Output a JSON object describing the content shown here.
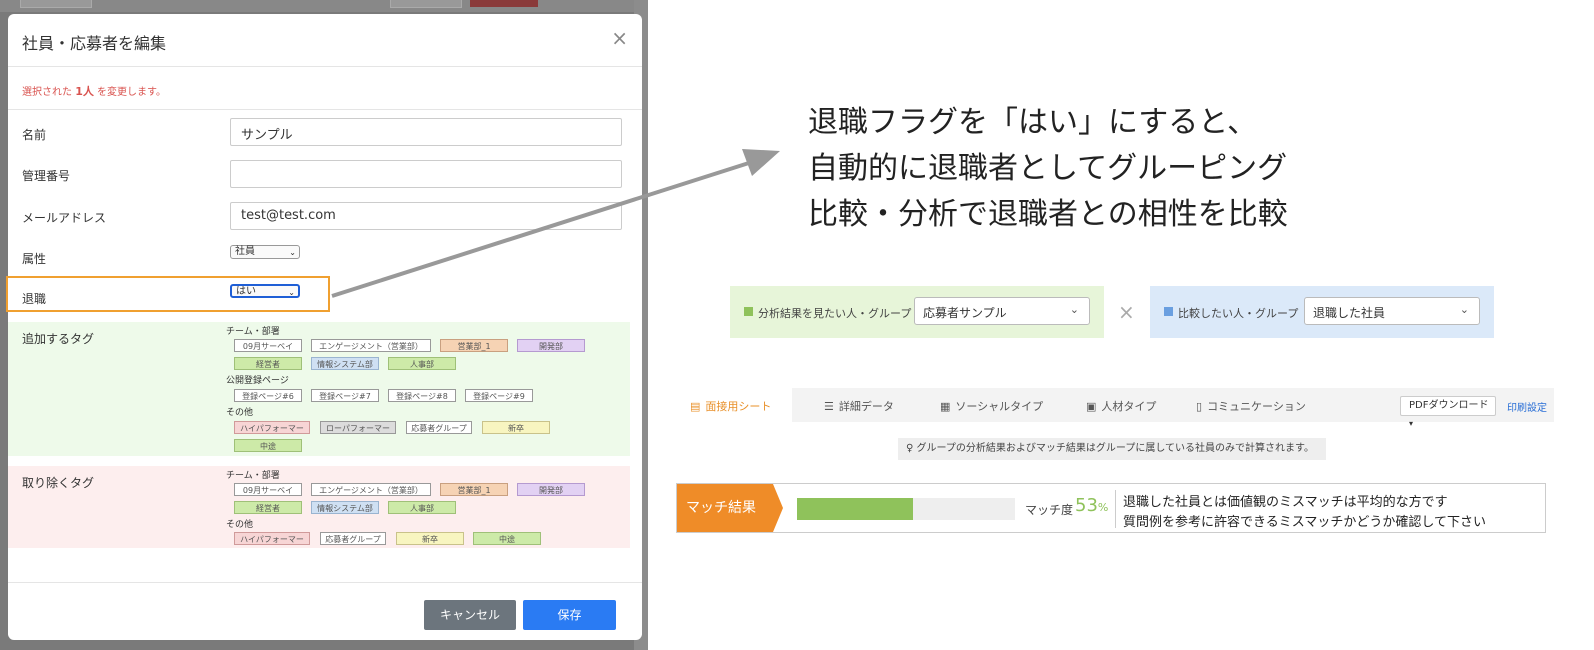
{
  "modal": {
    "title": "社員・応募者を編集",
    "close_glyph": "×",
    "notice_prefix": "選択された",
    "notice_count": "1人",
    "notice_suffix": "を変更します。",
    "fields": {
      "name_label": "名前",
      "name_value": "サンプル",
      "mgmt_label": "管理番号",
      "mgmt_value": "",
      "email_label": "メールアドレス",
      "email_value": "test@test.com",
      "attr_label": "属性",
      "attr_value": "社員",
      "retire_label": "退職",
      "retire_value": "はい"
    },
    "add_tags": {
      "label": "追加するタグ",
      "groups": [
        {
          "title": "チーム・部署",
          "tags": [
            "09月サーベイ",
            "エンゲージメント（営業部）",
            "営業部_1",
            "開発部",
            "経営者",
            "情報システム部",
            "人事部"
          ]
        },
        {
          "title": "公開登録ページ",
          "tags": [
            "登録ページ#6",
            "登録ページ#7",
            "登録ページ#8",
            "登録ページ#9"
          ]
        },
        {
          "title": "その他",
          "tags": [
            "ハイパフォーマー",
            "ローパフォーマー",
            "応募者グループ",
            "新卒",
            "中途"
          ]
        }
      ]
    },
    "remove_tags": {
      "label": "取り除くタグ",
      "groups": [
        {
          "title": "チーム・部署",
          "tags": [
            "09月サーベイ",
            "エンゲージメント（営業部）",
            "営業部_1",
            "開発部",
            "経営者",
            "情報システム部",
            "人事部"
          ]
        },
        {
          "title": "その他",
          "tags": [
            "ハイパフォーマー",
            "応募者グループ",
            "新卒",
            "中途"
          ]
        }
      ]
    },
    "cancel_label": "キャンセル",
    "save_label": "保存"
  },
  "annotation": {
    "line1": "退職フラグを「はい」にすると、",
    "line2": "自動的に退職者としてグルーピング",
    "line3": "比較・分析で退職者との相性を比較"
  },
  "compare": {
    "left_label": "分析結果を見たい人・グループ",
    "left_value": "応募者サンプル",
    "times": "×",
    "right_label": "比較したい人・グループ",
    "right_value": "退職した社員"
  },
  "tabs": [
    {
      "label": "面接用シート",
      "icon": "sheet-icon"
    },
    {
      "label": "詳細データ",
      "icon": "list-icon"
    },
    {
      "label": "ソーシャルタイプ",
      "icon": "grid-icon"
    },
    {
      "label": "人材タイプ",
      "icon": "person-icon"
    },
    {
      "label": "コミュニケーション",
      "icon": "doc-icon"
    }
  ],
  "pdf_label": "PDFダウンロード",
  "print_label": "印刷設定",
  "info_text": "グループの分析結果およびマッチ結果はグループに属している社員のみで計算されます。",
  "match": {
    "badge": "マッチ結果",
    "label": "マッチ度",
    "percent_value": 53,
    "percent_num": "53",
    "percent_sign": "%",
    "msg1": "退職した社員とは価値観のミスマッチは平均的な方です",
    "msg2": "質問例を参考に許容できるミスマッチかどうか確認して下さい"
  },
  "colors": {
    "accent_orange": "#ef8c28",
    "save_blue": "#2a7bf3",
    "match_green": "#8fc25b",
    "highlight_border": "#f0a030"
  }
}
